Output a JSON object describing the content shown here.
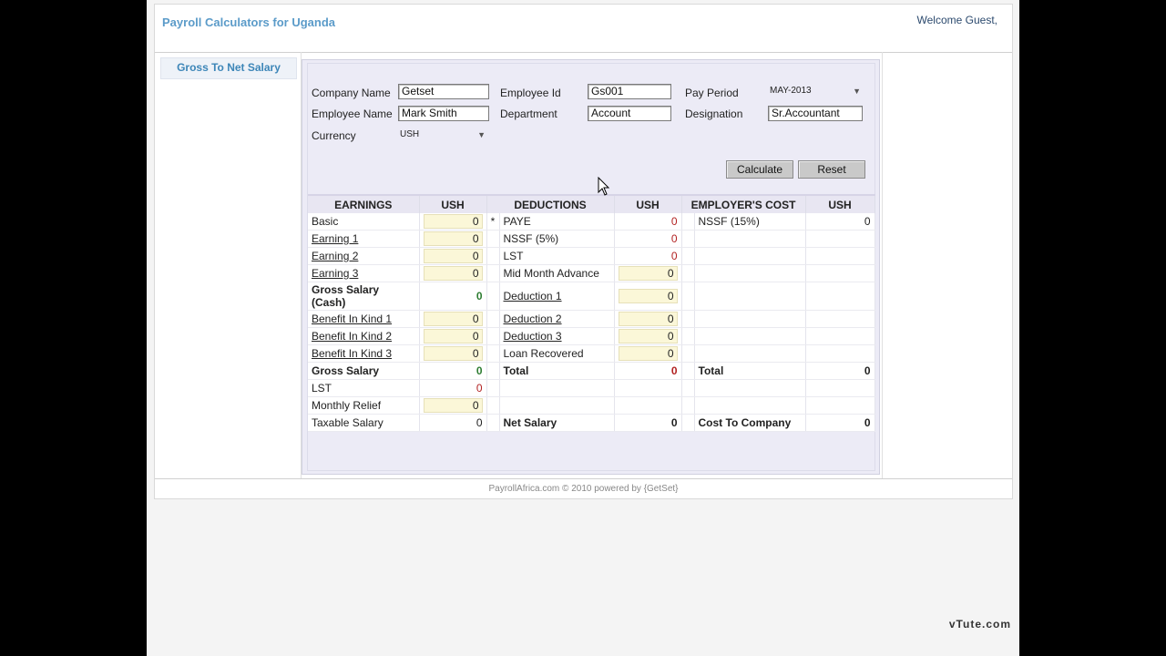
{
  "header": {
    "app_title": "Payroll Calculators for Uganda",
    "welcome": "Welcome Guest,"
  },
  "sidebar": {
    "gross_to_net": "Gross To Net Salary"
  },
  "form": {
    "company_name_label": "Company Name",
    "company_name_value": "Getset",
    "employee_id_label": "Employee Id",
    "employee_id_value": "Gs001",
    "pay_period_label": "Pay Period",
    "pay_period_value": "MAY-2013",
    "employee_name_label": "Employee Name",
    "employee_name_value": "Mark Smith",
    "department_label": "Department",
    "department_value": "Account",
    "designation_label": "Designation",
    "designation_value": "Sr.Accountant",
    "currency_label": "Currency",
    "currency_value": "USH",
    "calculate": "Calculate",
    "reset": "Reset"
  },
  "table": {
    "headers": [
      "EARNINGS",
      "USH",
      "DEDUCTIONS",
      "USH",
      "EMPLOYER'S COST",
      "USH"
    ],
    "rows": [
      {
        "e_label": "Basic",
        "e_val": "0",
        "star": "*",
        "d_label": "PAYE",
        "d_val": "0",
        "c_label": "NSSF (15%)",
        "c_val": "0"
      },
      {
        "e_label": "Earning 1",
        "e_val": "0",
        "d_label": "NSSF (5%)",
        "d_val": "0"
      },
      {
        "e_label": "Earning 2",
        "e_val": "0",
        "d_label": "LST",
        "d_val": "0"
      },
      {
        "e_label": "Earning 3",
        "e_val": "0",
        "d_label": "Mid Month Advance",
        "d_val": "0"
      },
      {
        "e_label": "Gross Salary (Cash)",
        "e_val": "0",
        "d_label": "Deduction 1",
        "d_val": "0"
      },
      {
        "e_label": "Benefit In Kind 1",
        "e_val": "0",
        "d_label": "Deduction 2",
        "d_val": "0"
      },
      {
        "e_label": "Benefit In Kind 2",
        "e_val": "0",
        "d_label": "Deduction 3",
        "d_val": "0"
      },
      {
        "e_label": "Benefit In Kind 3",
        "e_val": "0",
        "d_label": "Loan Recovered",
        "d_val": "0"
      },
      {
        "e_label": "Gross Salary",
        "e_val": "0",
        "d_label": "Total",
        "d_val": "0",
        "c_label": "Total",
        "c_val": "0"
      },
      {
        "e_label": "LST",
        "e_val": "0"
      },
      {
        "e_label": "Monthly Relief",
        "e_val": "0"
      },
      {
        "e_label": "Taxable Salary",
        "e_val": "0",
        "d_label": "Net Salary",
        "d_val": "0",
        "c_label": "Cost To Company",
        "c_val": "0"
      }
    ]
  },
  "footer": {
    "text": "PayrollAfrica.com © 2010 powered by {GetSet}"
  },
  "watermark": "vTute.com"
}
